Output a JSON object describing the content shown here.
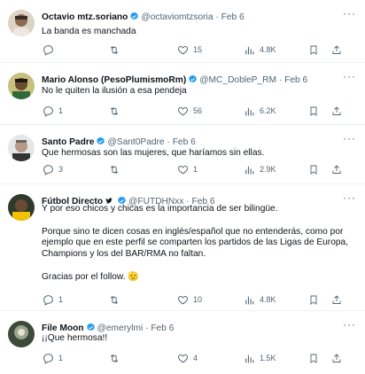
{
  "tweets": [
    {
      "name": "Octavio mtz.soriano",
      "handle": "@octaviomtzsoria",
      "date": "Feb 6",
      "verified": true,
      "text": "La banda es manchada",
      "replies": "",
      "retweets": "",
      "likes": "15",
      "views": "4.8K"
    },
    {
      "name": "Mario Alonso (PesoPlumismoRm)",
      "handle": "@MC_DobleP_RM",
      "date": "Feb 6",
      "verified": true,
      "text": "No le quiten la ilusión a esa pendeja",
      "replies": "1",
      "retweets": "",
      "likes": "56",
      "views": "6.2K"
    },
    {
      "name": "Santo Padre",
      "handle": "@Sant0Padre",
      "date": "Feb 6",
      "verified": true,
      "text": "Que hermosas son las mujeres, que haríamos sin ellas.",
      "replies": "3",
      "retweets": "",
      "likes": "1",
      "views": "2.9K"
    },
    {
      "name": "Fútbol Directo",
      "handle": "@FUTDHNxx",
      "date": "Feb 6",
      "verified": true,
      "text": "Y por eso chicos y chicas es la importancia de ser bilingüe.\n\nPorque sino te dicen cosas en inglés/español que no entenderás, como por ejemplo que en este perfil se comparten los partidos de las Ligas de Europa, Champions y los del BAR/RMA no faltan.\n\nGracias por el follow. 🫡",
      "replies": "1",
      "retweets": "",
      "likes": "10",
      "views": "4.8K"
    },
    {
      "name": "File Moon",
      "handle": "@emerylmi",
      "date": "Feb 6",
      "verified": true,
      "text": "¡¡Que hermosa!!",
      "replies": "1",
      "retweets": "",
      "likes": "4",
      "views": "1.5K"
    }
  ],
  "more_glyph": "···",
  "colors": {
    "verified": "#1d9bf0",
    "muted": "#536471",
    "text": "#0f1419",
    "divider": "#eff3f4"
  }
}
